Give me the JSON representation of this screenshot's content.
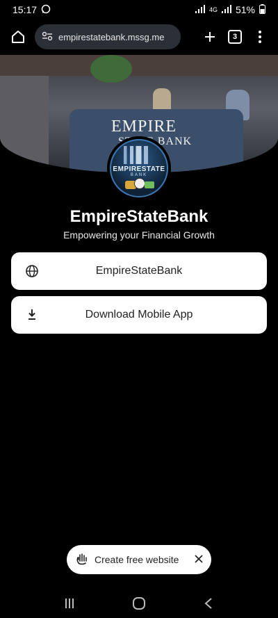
{
  "status_bar": {
    "time": "15:17",
    "network": "4G",
    "battery": "51%"
  },
  "browser": {
    "url": "empirestatebank.mssg.me",
    "tab_count": "3",
    "icons": [
      "home-icon",
      "site-settings-icon",
      "new-tab-plus-icon",
      "tabs-icon",
      "menu-dots-icon"
    ]
  },
  "hero": {
    "sign_line1": "EMPIRE",
    "sign_line2": "STATE BANK"
  },
  "logo": {
    "brand": "EMPIRESTATE",
    "sub": "BANK"
  },
  "profile": {
    "title": "EmpireStateBank",
    "subtitle": "Empowering your Financial Growth"
  },
  "links": [
    {
      "label": "EmpireStateBank",
      "icon": "globe-icon"
    },
    {
      "label": "Download Mobile App",
      "icon": "download-icon"
    }
  ],
  "create_banner": {
    "label": "Create free website",
    "icon": "hand-icon"
  },
  "nav": {
    "items": [
      "recent-apps-icon",
      "home-button-icon",
      "back-icon"
    ]
  },
  "colors": {
    "background": "#000000",
    "button_bg": "#ffffff",
    "url_pill_bg": "#2b2f36",
    "logo_ring": "#3b77b3"
  }
}
